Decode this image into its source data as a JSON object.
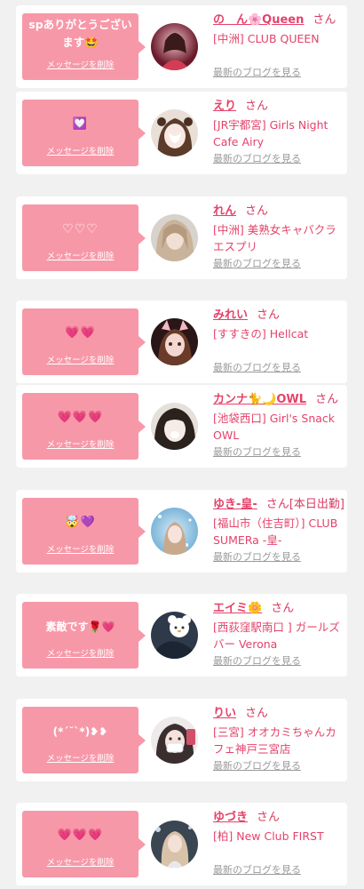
{
  "delete_label": "メッセージを削除",
  "san": "さん",
  "blog_label": "最新のブログを見る",
  "colors": {
    "accent_pink": "#f798a8",
    "name_pink": "#e5426a",
    "link_gray": "#9a9a9a",
    "background": "#f1f1f2"
  },
  "cards": [
    {
      "message": "spありがとうございます🤩",
      "name": "の　ん🌸Queen",
      "extra": "",
      "shop": "[中洲] CLUB QUEEN"
    },
    {
      "message": "💟",
      "name": "えり",
      "extra": "",
      "shop": "[JR宇都宮] Girls Night Cafe Airy"
    },
    {
      "message": "♡♡♡",
      "name": "れん",
      "extra": "",
      "shop": "[中洲] 美熟女キャバクラ エスプリ"
    },
    {
      "message": "💗💗",
      "name": "みれい",
      "extra": "",
      "shop": "[すすきの] Hellcat"
    },
    {
      "message": "💗💗💗",
      "name": "カンナ🐈🌙OWL",
      "extra": "",
      "shop": "[池袋西口] Girl's Snack OWL"
    },
    {
      "message": "🤯💜",
      "name": "ゆき-皇-",
      "extra": "[本日出勤]",
      "shop": "[福山市（住吉町）] CLUB SUMERa -皇-"
    },
    {
      "message": "素敵です🌹💗",
      "name": "エイミ🌼",
      "extra": "",
      "shop": "[西荻窪駅南口 ] ガールズバー Verona"
    },
    {
      "message": "(*ˊ˘ˋ*)❥❥",
      "name": "りい",
      "extra": "",
      "shop": "[三宮] オオカミちゃんカフェ神戸三宮店"
    },
    {
      "message": "💗💗💗",
      "name": "ゆづき",
      "extra": "",
      "shop": "[柏] New Club FIRST"
    }
  ]
}
